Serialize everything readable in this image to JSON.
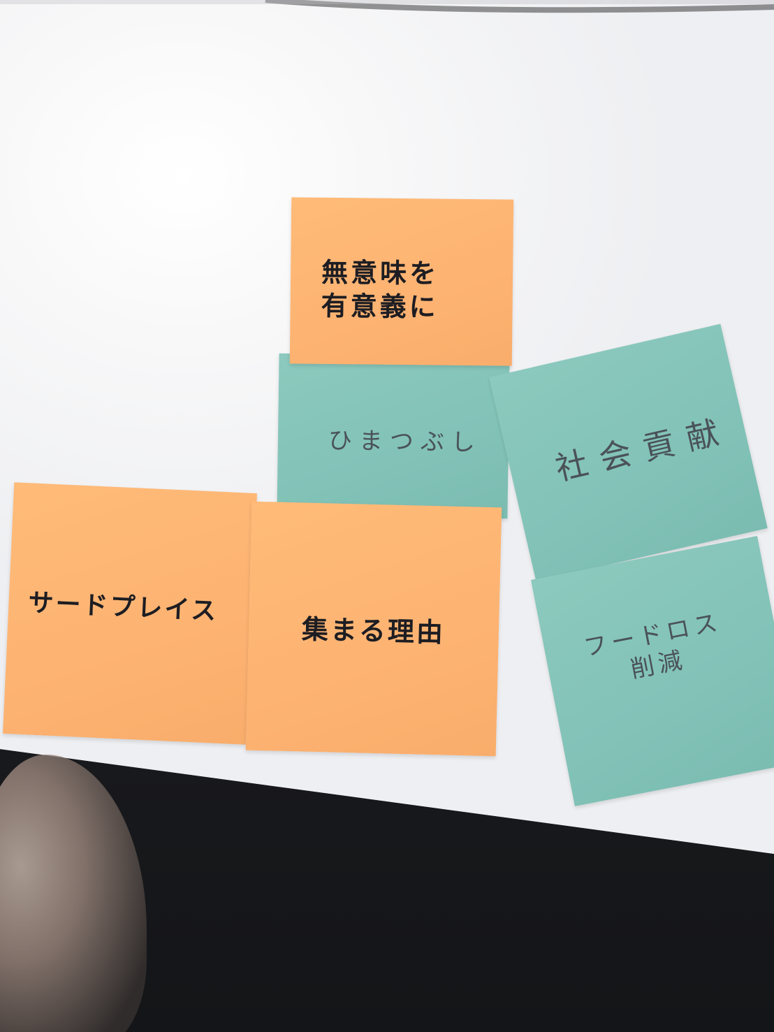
{
  "notes": {
    "meaningless": "無意味を\n有意義に",
    "kill_time": "ひまつぶし",
    "social": "社会貢献",
    "third_place": "サードプレイス",
    "reason": "集まる理由",
    "food_loss": "フードロス\n削減"
  },
  "colors": {
    "orange_note": "#fdb372",
    "teal_note": "#82c2b7",
    "table": "#f2f3f5",
    "ink": "#1d1d22"
  }
}
